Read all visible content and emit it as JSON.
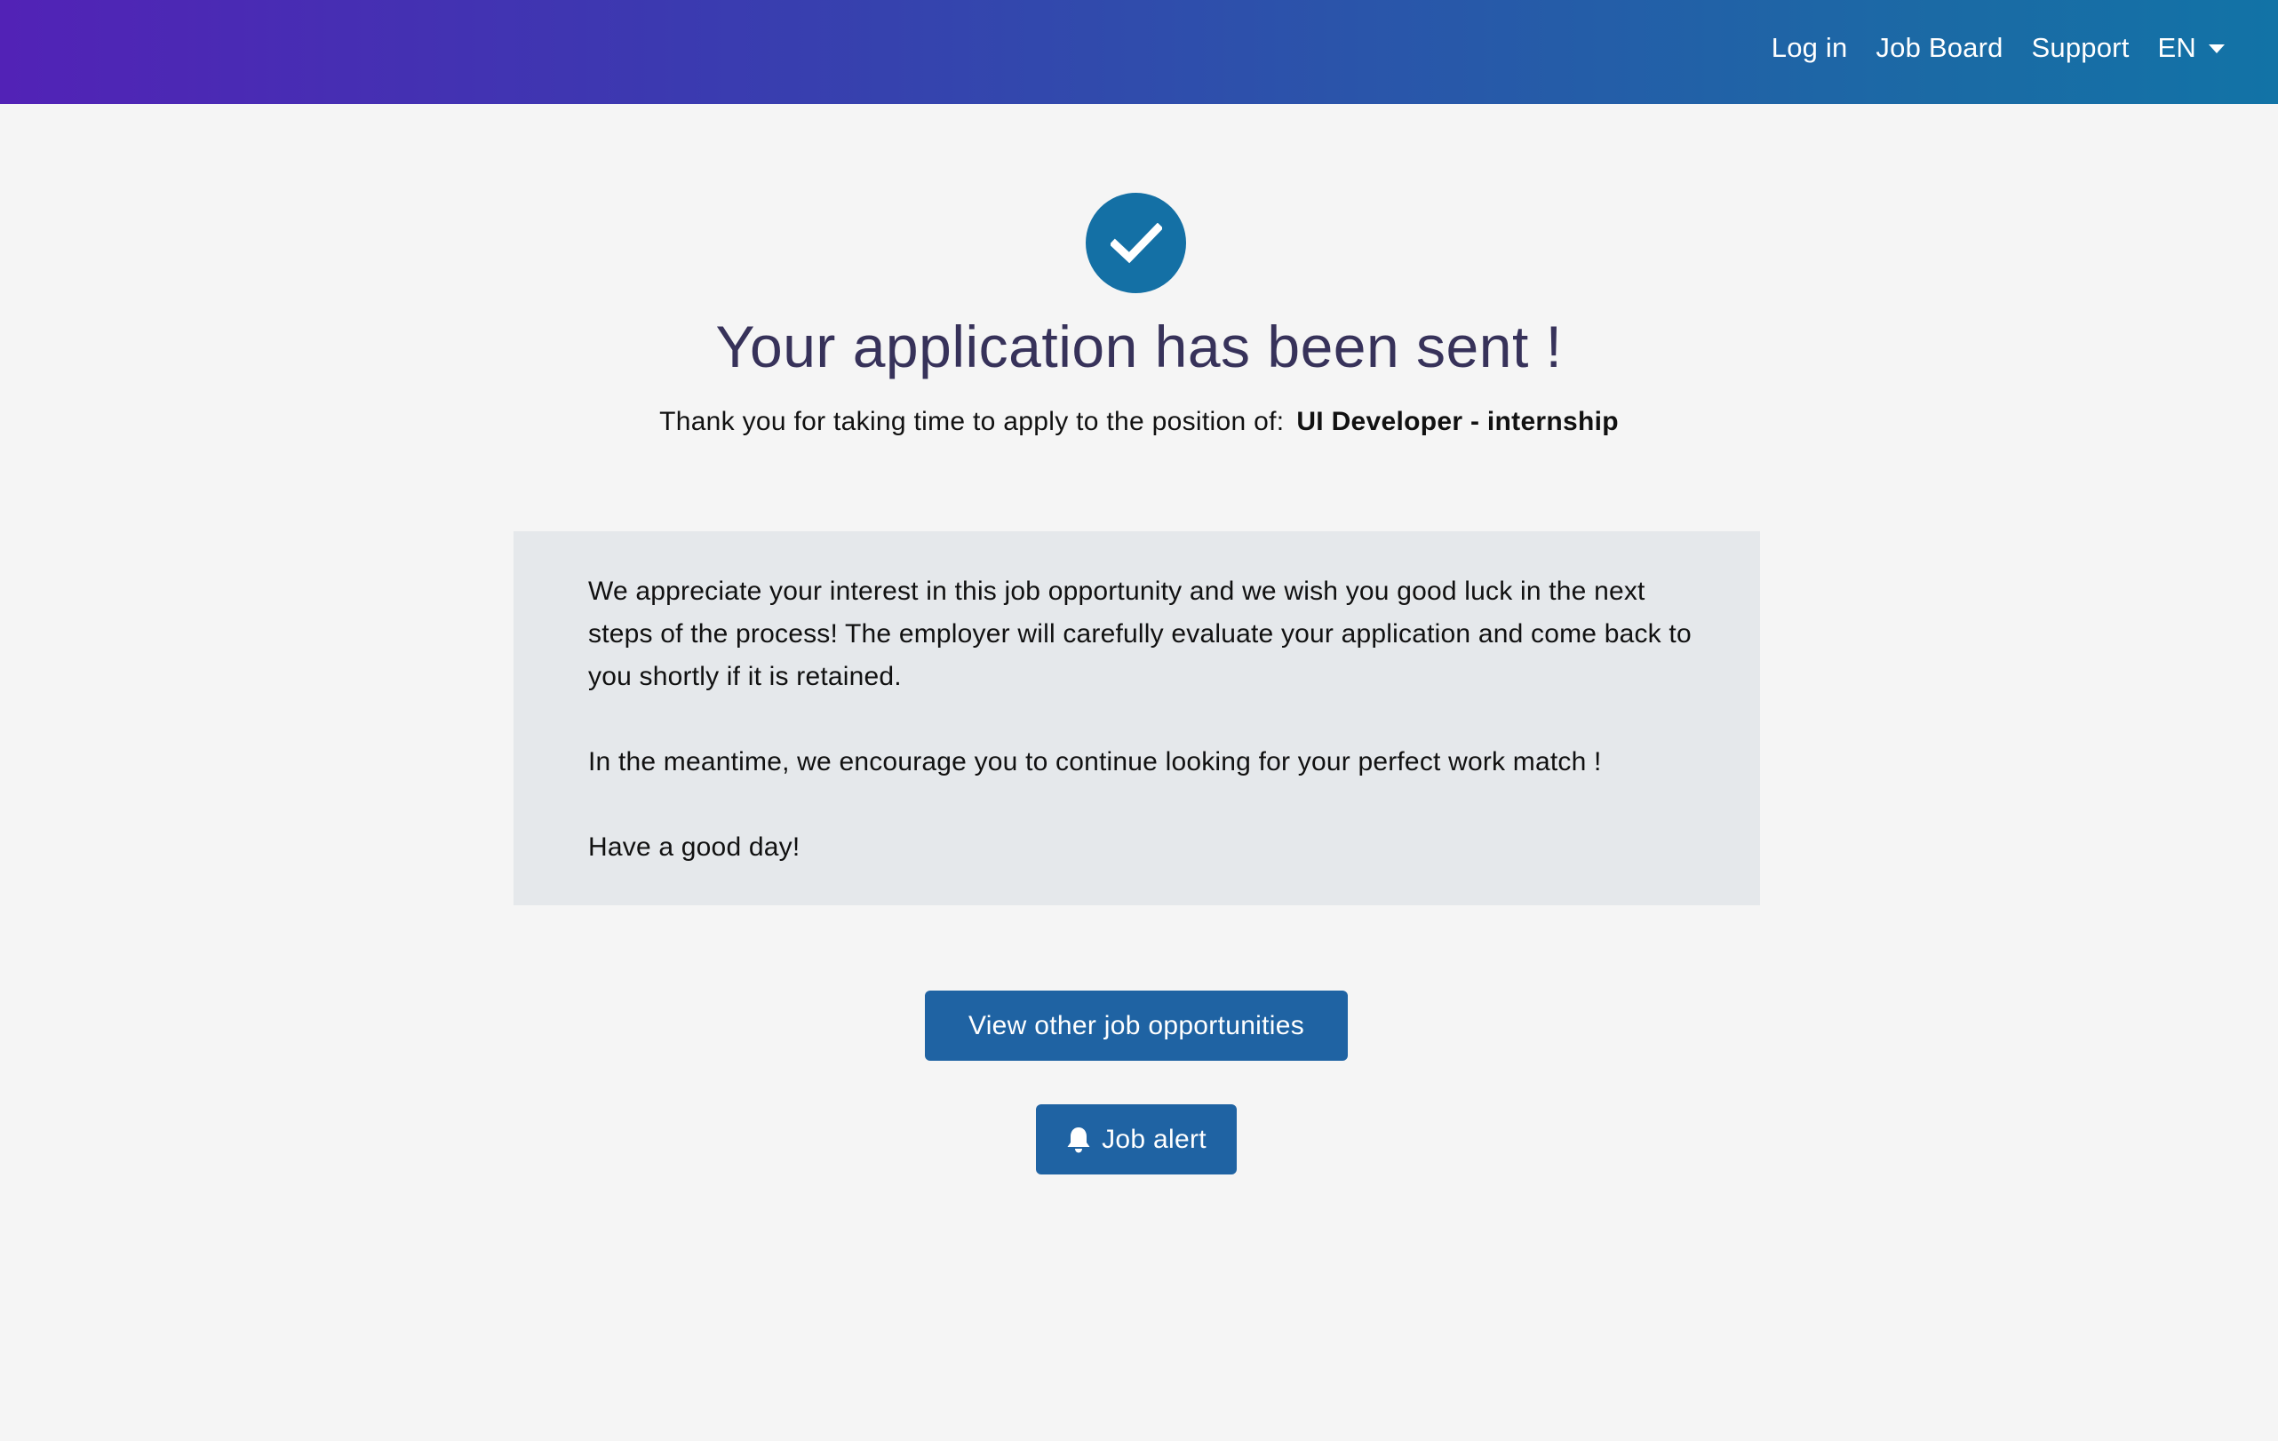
{
  "nav": {
    "login": "Log in",
    "job_board": "Job Board",
    "support": "Support",
    "language": "EN"
  },
  "confirmation": {
    "title": "Your application has been sent !",
    "subtitle_prefix": "Thank you for taking time to apply to the position of:",
    "position": "UI Developer - internship"
  },
  "message": {
    "paragraph1": "We appreciate your interest in this job opportunity and we wish you good luck in the next steps of the process! The employer will carefully evaluate your application and come back to you shortly if it is retained.",
    "paragraph2": "In the meantime, we encourage you to continue looking for your perfect work match !",
    "paragraph3": "Have a good day!"
  },
  "actions": {
    "view_jobs_label": "View other job opportunities",
    "job_alert_label": "Job alert"
  },
  "colors": {
    "header_gradient_start": "#5222b6",
    "header_gradient_end": "#1273a6",
    "accent": "#1470a5",
    "button": "#1f63a3",
    "title": "#37325a",
    "panel": "#e5e8eb"
  },
  "icons": {
    "success": "checkmark-circle-icon",
    "alert": "bell-icon",
    "language_dropdown": "caret-down-icon"
  }
}
